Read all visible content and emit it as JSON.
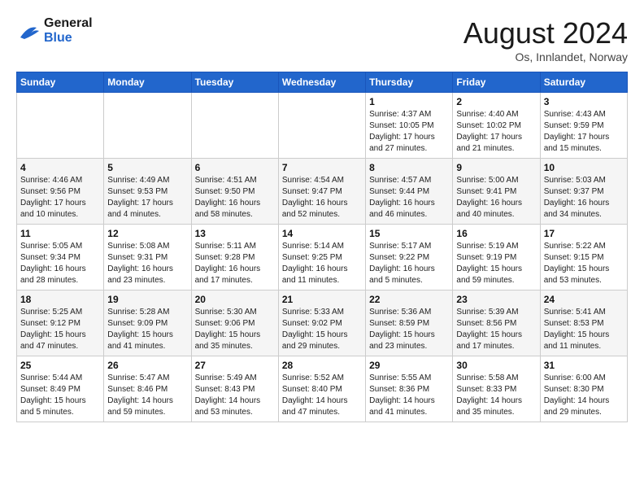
{
  "header": {
    "logo_line1": "General",
    "logo_line2": "Blue",
    "month_year": "August 2024",
    "location": "Os, Innlandet, Norway"
  },
  "weekdays": [
    "Sunday",
    "Monday",
    "Tuesday",
    "Wednesday",
    "Thursday",
    "Friday",
    "Saturday"
  ],
  "weeks": [
    [
      {
        "day": "",
        "info": ""
      },
      {
        "day": "",
        "info": ""
      },
      {
        "day": "",
        "info": ""
      },
      {
        "day": "",
        "info": ""
      },
      {
        "day": "1",
        "info": "Sunrise: 4:37 AM\nSunset: 10:05 PM\nDaylight: 17 hours\nand 27 minutes."
      },
      {
        "day": "2",
        "info": "Sunrise: 4:40 AM\nSunset: 10:02 PM\nDaylight: 17 hours\nand 21 minutes."
      },
      {
        "day": "3",
        "info": "Sunrise: 4:43 AM\nSunset: 9:59 PM\nDaylight: 17 hours\nand 15 minutes."
      }
    ],
    [
      {
        "day": "4",
        "info": "Sunrise: 4:46 AM\nSunset: 9:56 PM\nDaylight: 17 hours\nand 10 minutes."
      },
      {
        "day": "5",
        "info": "Sunrise: 4:49 AM\nSunset: 9:53 PM\nDaylight: 17 hours\nand 4 minutes."
      },
      {
        "day": "6",
        "info": "Sunrise: 4:51 AM\nSunset: 9:50 PM\nDaylight: 16 hours\nand 58 minutes."
      },
      {
        "day": "7",
        "info": "Sunrise: 4:54 AM\nSunset: 9:47 PM\nDaylight: 16 hours\nand 52 minutes."
      },
      {
        "day": "8",
        "info": "Sunrise: 4:57 AM\nSunset: 9:44 PM\nDaylight: 16 hours\nand 46 minutes."
      },
      {
        "day": "9",
        "info": "Sunrise: 5:00 AM\nSunset: 9:41 PM\nDaylight: 16 hours\nand 40 minutes."
      },
      {
        "day": "10",
        "info": "Sunrise: 5:03 AM\nSunset: 9:37 PM\nDaylight: 16 hours\nand 34 minutes."
      }
    ],
    [
      {
        "day": "11",
        "info": "Sunrise: 5:05 AM\nSunset: 9:34 PM\nDaylight: 16 hours\nand 28 minutes."
      },
      {
        "day": "12",
        "info": "Sunrise: 5:08 AM\nSunset: 9:31 PM\nDaylight: 16 hours\nand 23 minutes."
      },
      {
        "day": "13",
        "info": "Sunrise: 5:11 AM\nSunset: 9:28 PM\nDaylight: 16 hours\nand 17 minutes."
      },
      {
        "day": "14",
        "info": "Sunrise: 5:14 AM\nSunset: 9:25 PM\nDaylight: 16 hours\nand 11 minutes."
      },
      {
        "day": "15",
        "info": "Sunrise: 5:17 AM\nSunset: 9:22 PM\nDaylight: 16 hours\nand 5 minutes."
      },
      {
        "day": "16",
        "info": "Sunrise: 5:19 AM\nSunset: 9:19 PM\nDaylight: 15 hours\nand 59 minutes."
      },
      {
        "day": "17",
        "info": "Sunrise: 5:22 AM\nSunset: 9:15 PM\nDaylight: 15 hours\nand 53 minutes."
      }
    ],
    [
      {
        "day": "18",
        "info": "Sunrise: 5:25 AM\nSunset: 9:12 PM\nDaylight: 15 hours\nand 47 minutes."
      },
      {
        "day": "19",
        "info": "Sunrise: 5:28 AM\nSunset: 9:09 PM\nDaylight: 15 hours\nand 41 minutes."
      },
      {
        "day": "20",
        "info": "Sunrise: 5:30 AM\nSunset: 9:06 PM\nDaylight: 15 hours\nand 35 minutes."
      },
      {
        "day": "21",
        "info": "Sunrise: 5:33 AM\nSunset: 9:02 PM\nDaylight: 15 hours\nand 29 minutes."
      },
      {
        "day": "22",
        "info": "Sunrise: 5:36 AM\nSunset: 8:59 PM\nDaylight: 15 hours\nand 23 minutes."
      },
      {
        "day": "23",
        "info": "Sunrise: 5:39 AM\nSunset: 8:56 PM\nDaylight: 15 hours\nand 17 minutes."
      },
      {
        "day": "24",
        "info": "Sunrise: 5:41 AM\nSunset: 8:53 PM\nDaylight: 15 hours\nand 11 minutes."
      }
    ],
    [
      {
        "day": "25",
        "info": "Sunrise: 5:44 AM\nSunset: 8:49 PM\nDaylight: 15 hours\nand 5 minutes."
      },
      {
        "day": "26",
        "info": "Sunrise: 5:47 AM\nSunset: 8:46 PM\nDaylight: 14 hours\nand 59 minutes."
      },
      {
        "day": "27",
        "info": "Sunrise: 5:49 AM\nSunset: 8:43 PM\nDaylight: 14 hours\nand 53 minutes."
      },
      {
        "day": "28",
        "info": "Sunrise: 5:52 AM\nSunset: 8:40 PM\nDaylight: 14 hours\nand 47 minutes."
      },
      {
        "day": "29",
        "info": "Sunrise: 5:55 AM\nSunset: 8:36 PM\nDaylight: 14 hours\nand 41 minutes."
      },
      {
        "day": "30",
        "info": "Sunrise: 5:58 AM\nSunset: 8:33 PM\nDaylight: 14 hours\nand 35 minutes."
      },
      {
        "day": "31",
        "info": "Sunrise: 6:00 AM\nSunset: 8:30 PM\nDaylight: 14 hours\nand 29 minutes."
      }
    ]
  ]
}
